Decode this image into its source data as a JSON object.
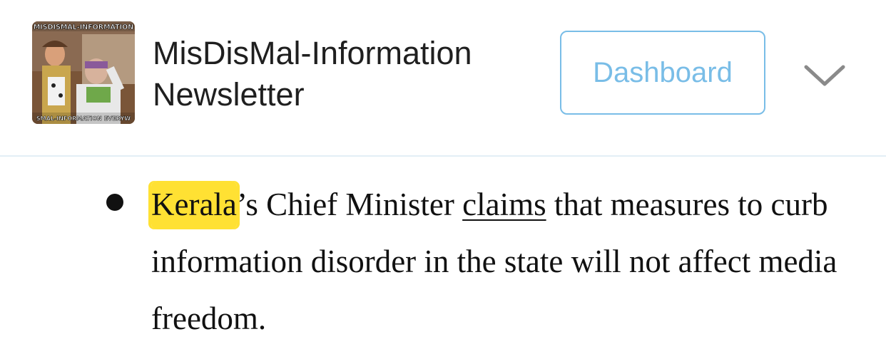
{
  "header": {
    "logo_alt_top": "MISDISMAL-INFORMATION",
    "logo_alt_bottom": "SMAL-INFORMATION EVERYW",
    "title_line1": "MisDisMal-Information",
    "title_line2": "Newsletter",
    "dashboard_label": "Dashboard",
    "menu_icon": "chevron-down-icon"
  },
  "article": {
    "bullet_highlight": "Kerala",
    "bullet_text_1": "’s Chief Minister ",
    "bullet_link": "claims",
    "bullet_text_2": " that measures to curb information disorder in the state will not affect media freedom."
  },
  "colors": {
    "accent": "#79bde7",
    "highlight": "#ffe133",
    "divider": "#e3eef6",
    "text": "#111111"
  }
}
